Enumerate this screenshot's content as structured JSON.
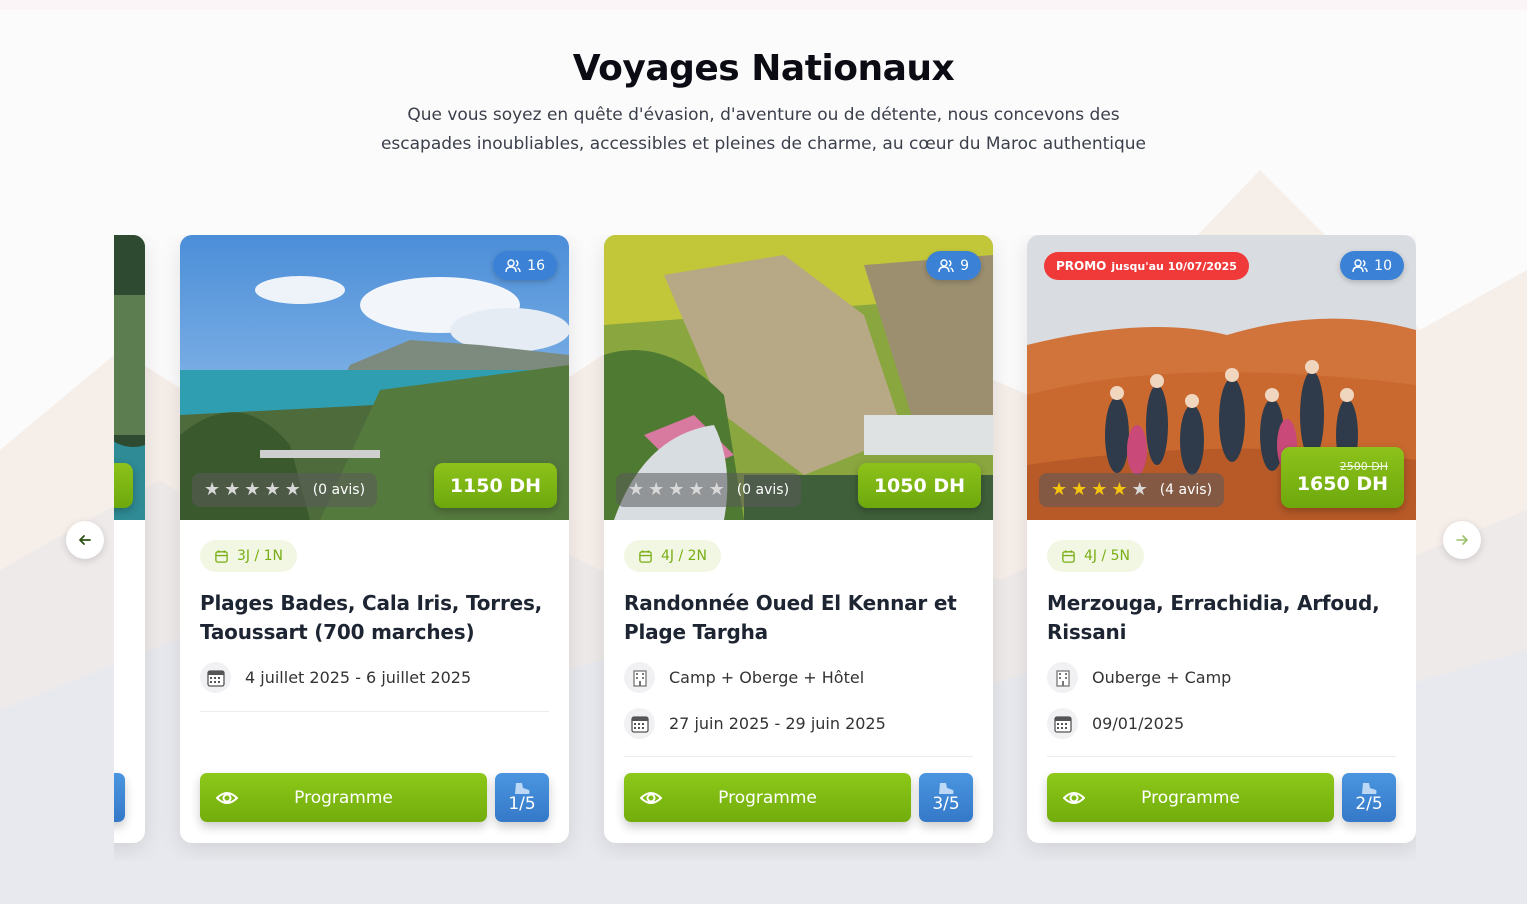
{
  "section": {
    "title": "Voyages Nationaux",
    "subtitle": "Que vous soyez en quête d'évasion, d'aventure ou de détente, nous concevons des escapades inoubliables, accessibles et pleines de charme, au cœur du Maroc authentique"
  },
  "nav": {
    "prev_icon": "arrow-left-icon",
    "next_icon": "arrow-right-icon"
  },
  "colors": {
    "green": "#7fb814",
    "blue": "#3b82d6",
    "promo": "#f03a3a",
    "star": "#f5c40f"
  },
  "cards": [
    {
      "participants": "16",
      "rating_stars": 0,
      "reviews": "(0 avis)",
      "price": "1150 DH",
      "duration": "3J / 1N",
      "title": "Plages Bades, Cala Iris, Torres, Taoussart (700 marches)",
      "dates": "4 juillet 2025 - 6 juillet 2025",
      "program_label": "Programme",
      "difficulty": "1/5"
    },
    {
      "participants": "9",
      "rating_stars": 0,
      "reviews": "(0 avis)",
      "price": "1050 DH",
      "duration": "4J / 2N",
      "title": "Randonnée Oued El Kennar et Plage Targha",
      "lodging": "Camp + Oberge + Hôtel",
      "dates": "27 juin 2025 - 29 juin 2025",
      "program_label": "Programme",
      "difficulty": "3/5"
    },
    {
      "promo_label": "PROMO",
      "promo_until": "jusqu'au 10/07/2025",
      "participants": "10",
      "rating_stars": 4,
      "reviews": "(4 avis)",
      "old_price": "2500 DH",
      "price": "1650 DH",
      "duration": "4J / 5N",
      "title": "Merzouga, Errachidia, Arfoud, Rissani",
      "lodging": "Ouberge + Camp",
      "dates": "09/01/2025",
      "program_label": "Programme",
      "difficulty": "2/5"
    }
  ]
}
